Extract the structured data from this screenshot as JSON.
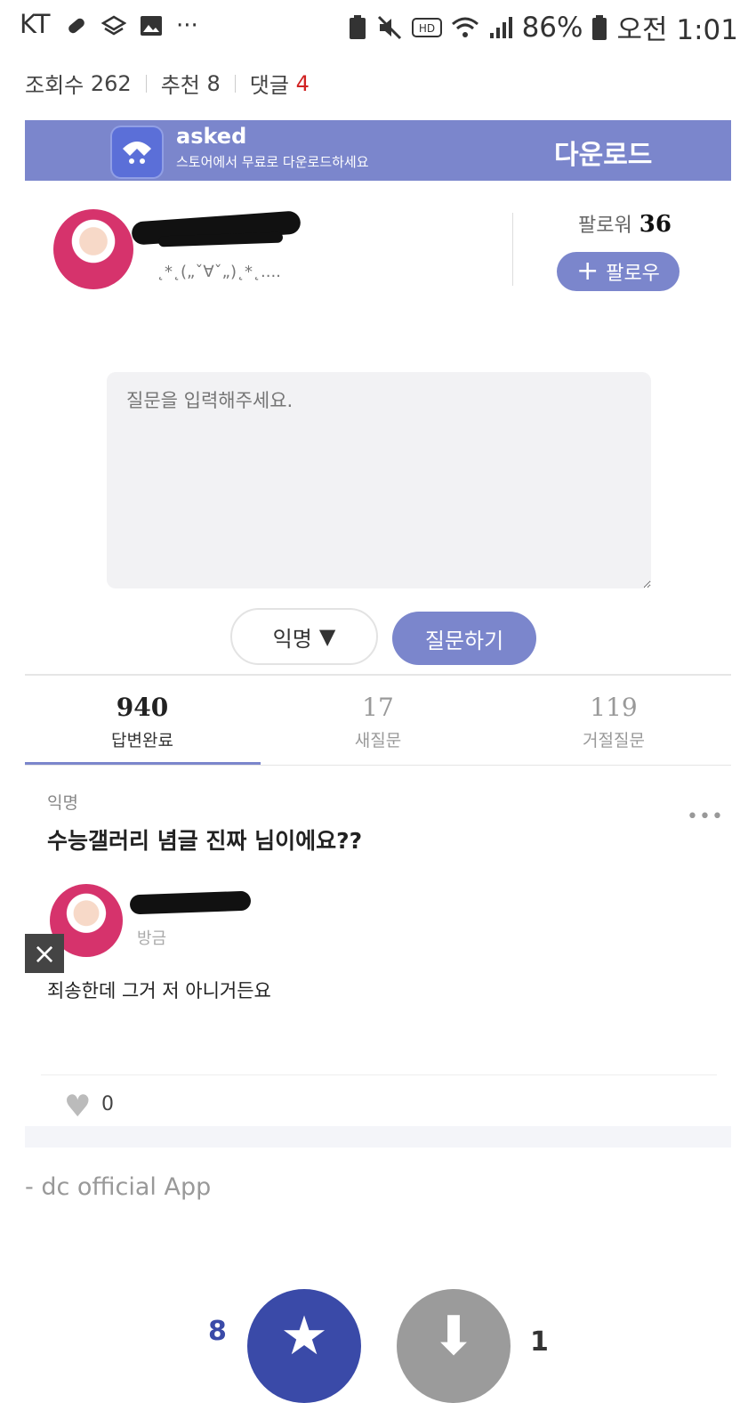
{
  "status_bar": {
    "carrier": "KT",
    "battery": "86%",
    "time": "오전 1:01"
  },
  "post_stats": {
    "views_label": "조회수",
    "views": "262",
    "recommend_label": "추천",
    "recommend": "8",
    "comments_label": "댓글",
    "comments": "4"
  },
  "embed": {
    "banner": {
      "app_name": "asked",
      "tagline": "스토어에서 무료로 다운로드하세요",
      "download": "다운로드"
    },
    "profile": {
      "bio": "˛*˛(„ˇ∀ˇ„)˛*˛....",
      "followers_label": "팔로워",
      "followers": "36",
      "follow_button": "팔로우"
    },
    "question_form": {
      "placeholder": "질문을 입력해주세요.",
      "anon_button": "익명",
      "ask_button": "질문하기"
    },
    "tabs": [
      {
        "count": "940",
        "label": "답변완료"
      },
      {
        "count": "17",
        "label": "새질문"
      },
      {
        "count": "119",
        "label": "거절질문"
      }
    ],
    "question": {
      "asker": "익명",
      "text": "수능갤러리 념글 진짜 님이에요??"
    },
    "answer": {
      "time": "방금",
      "text": "죄송한데 그거 저 아니거든요",
      "likes": "0"
    }
  },
  "signature": "- dc official App",
  "votes": {
    "up": "8",
    "down": "1"
  }
}
